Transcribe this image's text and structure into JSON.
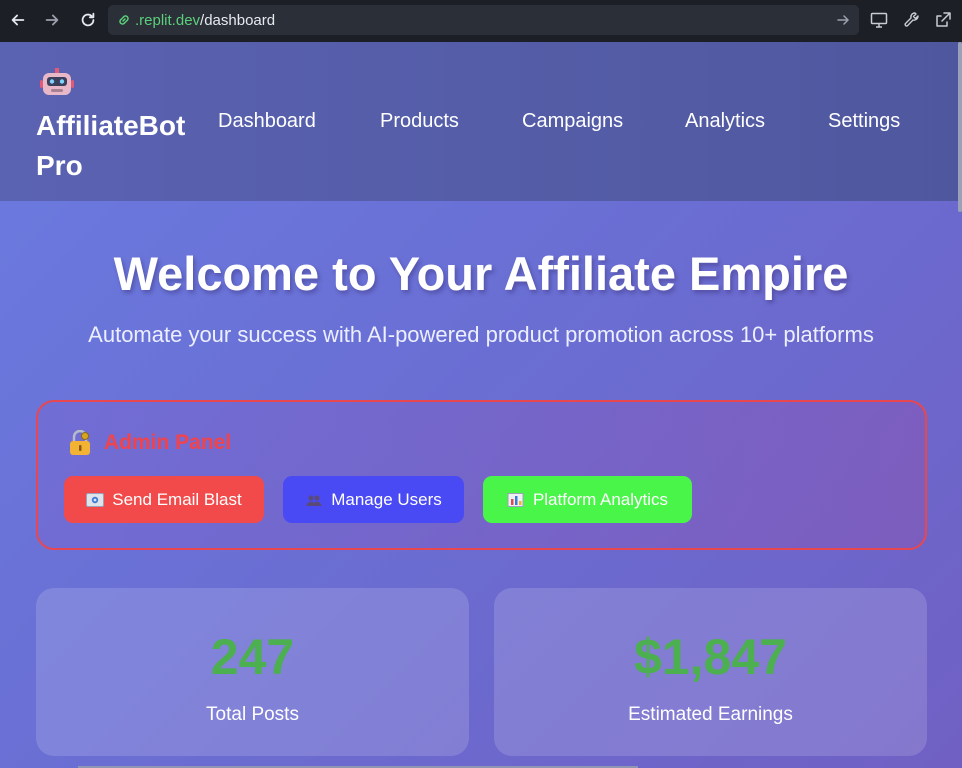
{
  "browser": {
    "url_domain": ".replit.dev",
    "url_path": "/dashboard"
  },
  "site": {
    "brand_icon": "robot-icon",
    "brand_name": "AffiliateBot Pro",
    "nav": [
      {
        "label": "Dashboard"
      },
      {
        "label": "Products"
      },
      {
        "label": "Campaigns"
      },
      {
        "label": "Analytics"
      },
      {
        "label": "Settings"
      }
    ]
  },
  "hero": {
    "title": "Welcome to Your Affiliate Empire",
    "subtitle": "Automate your success with AI-powered product promotion across 10+ platforms"
  },
  "admin": {
    "icon": "lock-key-icon",
    "title": "Admin Panel",
    "buttons": [
      {
        "label": "Send Email Blast",
        "icon": "email-icon",
        "color": "#f24a4a"
      },
      {
        "label": "Manage Users",
        "icon": "users-icon",
        "color": "#4a4af5"
      },
      {
        "label": "Platform Analytics",
        "icon": "bar-chart-icon",
        "color": "#4af54a"
      }
    ],
    "border_color": "#e8474f"
  },
  "stats": [
    {
      "value": "247",
      "label": "Total Posts"
    },
    {
      "value": "$1,847",
      "label": "Estimated Earnings"
    }
  ],
  "colors": {
    "stat_value": "#4caf50",
    "admin_title": "#f0434c"
  }
}
